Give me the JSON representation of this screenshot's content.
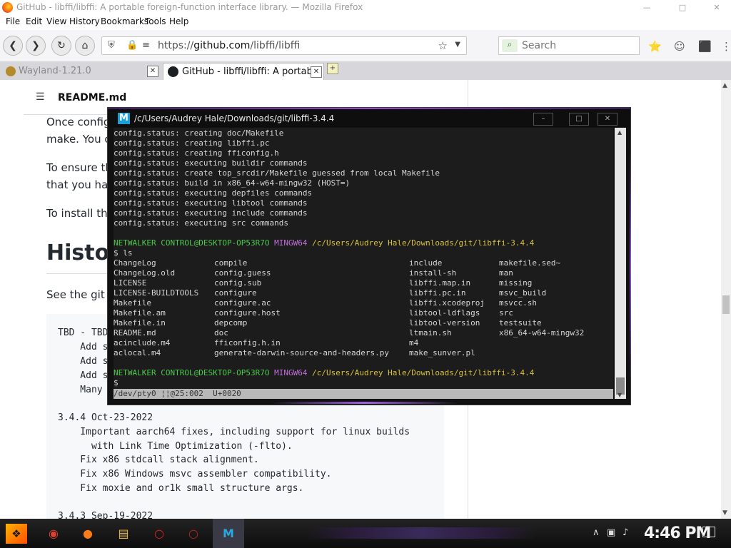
{
  "window": {
    "title": "GitHub - libffi/libffi: A portable foreign-function interface library. — Mozilla Firefox",
    "buttons": [
      "—",
      "□",
      "✕"
    ]
  },
  "menu": [
    "File",
    "Edit",
    "View",
    "History",
    "Bookmarks",
    "Tools",
    "Help"
  ],
  "nav": {
    "url_prefix": "https://",
    "url_domain": "github.com",
    "url_path": "/libffi/libffi",
    "search_placeholder": "Search"
  },
  "tabs": [
    {
      "title": "Wayland-1.21.0",
      "active": false
    },
    {
      "title": "GitHub - libffi/libffi: A portabl",
      "active": true
    }
  ],
  "page": {
    "readme_title": "README.md",
    "paragraphs": [
      "Once config",
      "make. You ca",
      "To ensure th",
      "that you hav",
      "To install the"
    ],
    "heading": "Histo",
    "see_git": "See the git lo",
    "code": [
      "TBD - TBD",
      "    Add s",
      "    Add s",
      "    Add s",
      "    Many",
      "",
      "3.4.4 Oct-23-2022",
      "    Important aarch64 fixes, including support for linux builds",
      "      with Link Time Optimization (-flto).",
      "    Fix x86 stdcall stack alignment.",
      "    Fix x86 Windows msvc assembler compatibility.",
      "    Fix moxie and or1k small structure args.",
      "",
      "3.4.3 Sep-19-2022"
    ]
  },
  "terminal": {
    "title": "/c/Users/Audrey Hale/Downloads/git/libffi-3.4.4",
    "config_lines": [
      "config.status: creating doc/Makefile",
      "config.status: creating libffi.pc",
      "config.status: creating fficonfig.h",
      "config.status: executing buildir commands",
      "config.status: create top_srcdir/Makefile guessed from local Makefile",
      "config.status: build in x86_64-w64-mingw32 (HOST=)",
      "config.status: executing depfiles commands",
      "config.status: executing libtool commands",
      "config.status: executing include commands",
      "config.status: executing src commands"
    ],
    "prompt_user": "NETWALKER CONTROL@DESKTOP-OP53R7O",
    "prompt_env": "MINGW64",
    "prompt_path": "/c/Users/Audrey Hale/Downloads/git/libffi-3.4.4",
    "command": "$ ls",
    "ls_columns": [
      [
        "ChangeLog",
        "ChangeLog.old",
        "LICENSE",
        "LICENSE-BUILDTOOLS",
        "Makefile",
        "Makefile.am",
        "Makefile.in",
        "README.md",
        "acinclude.m4",
        "aclocal.m4"
      ],
      [
        "compile",
        "config.guess",
        "config.sub",
        "configure",
        "configure.ac",
        "configure.host",
        "depcomp",
        "doc",
        "fficonfig.h.in",
        "generate-darwin-source-and-headers.py"
      ],
      [
        "include",
        "install-sh",
        "libffi.map.in",
        "libffi.pc.in",
        "libffi.xcodeproj",
        "libtool-ldflags",
        "libtool-version",
        "ltmain.sh",
        "m4",
        "make_sunver.pl"
      ],
      [
        "makefile.sed~",
        "man",
        "missing",
        "msvc_build",
        "msvcc.sh",
        "src",
        "testsuite",
        "x86_64-w64-mingw32",
        "",
        ""
      ]
    ],
    "final_prompt": "$",
    "status": "/dev/pty0 ¦¦@25:002  U+0020"
  },
  "taskbar": {
    "clock": "4:46 PM"
  }
}
